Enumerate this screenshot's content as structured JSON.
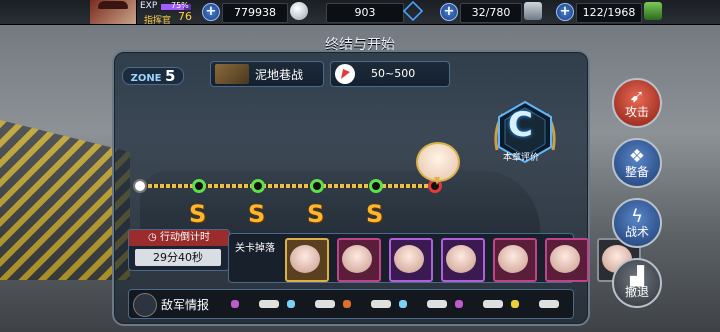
{
  "topbar": {
    "exp_label": "EXP",
    "exp_percent": "75%",
    "exp_fill": 0.75,
    "rank_label": "指挥官",
    "level": "76",
    "resources": [
      {
        "name": "fuel",
        "icon": "coin-icon",
        "value": "779938"
      },
      {
        "name": "ammo",
        "icon": "pearl-icon",
        "value": "903"
      },
      {
        "name": "steel",
        "icon": "cube-icon",
        "value": "32/780"
      },
      {
        "name": "supply",
        "icon": "canister-icon",
        "value": "122/1968"
      }
    ]
  },
  "page": {
    "title": "终结与开始",
    "zone_label": "ZONE",
    "zone_number": "5",
    "stage_name": "泥地巷战",
    "cost_range": "50~500",
    "chapter_grade": "C",
    "chapter_grade_label": "本章评价"
  },
  "map": {
    "ranks": [
      "S",
      "S",
      "S",
      "S"
    ]
  },
  "timer": {
    "label": "行动倒计时",
    "value": "29分40秒"
  },
  "drops": {
    "label": "关卡掉落",
    "items": [
      {
        "border": "#d9b24a",
        "bg": "#5a4020"
      },
      {
        "border": "#c0448a",
        "bg": "#5a1e3a"
      },
      {
        "border": "#b060d8",
        "bg": "#3a1a50"
      },
      {
        "border": "#b060d8",
        "bg": "#3a1a50"
      },
      {
        "border": "#c0448a",
        "bg": "#5a1e3a"
      },
      {
        "border": "#c0448a",
        "bg": "#5a1e3a"
      },
      {
        "border": "#8a8f95",
        "bg": "#2a2e33"
      }
    ]
  },
  "enemy": {
    "label": "敌军情报",
    "units": [
      {
        "color": "#c05ad0"
      },
      {
        "color": "#e0e0e0"
      },
      {
        "color": "#7ad0f0"
      },
      {
        "color": "#e0e0e0"
      },
      {
        "color": "#e26a2a"
      },
      {
        "color": "#e0e0e0"
      },
      {
        "color": "#7ad0f0"
      },
      {
        "color": "#e0e0e0"
      },
      {
        "color": "#c05ad0"
      },
      {
        "color": "#e0e0e0"
      },
      {
        "color": "#e8d23a"
      },
      {
        "color": "#e0e0e0"
      }
    ]
  },
  "side_buttons": {
    "attack": "攻击",
    "prepare": "整备",
    "tactics": "战术",
    "retreat": "撤退"
  }
}
